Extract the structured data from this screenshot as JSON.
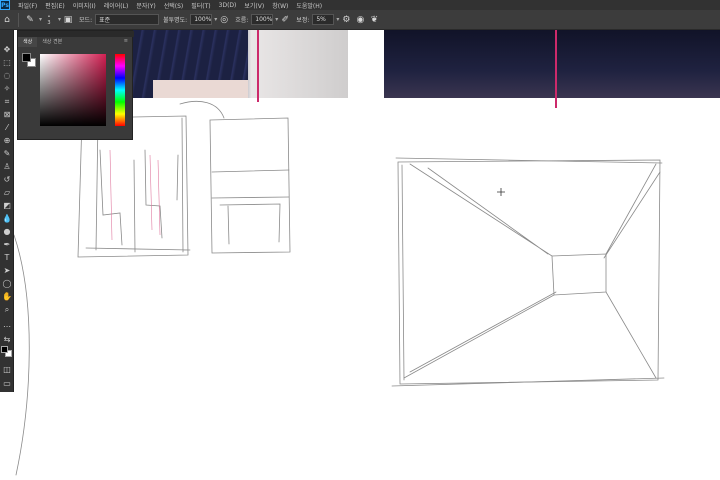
{
  "menubar": {
    "logo": "Ps",
    "items": [
      "파일(F)",
      "편집(E)",
      "이미지(I)",
      "레이어(L)",
      "문자(Y)",
      "선택(S)",
      "필터(T)",
      "3D(D)",
      "보기(V)",
      "창(W)",
      "도움말(H)"
    ]
  },
  "options": {
    "brush_size": "3",
    "mode_label": "모드:",
    "mode_value": "표준",
    "opacity_label": "불투명도:",
    "opacity_value": "100%",
    "flow_label": "흐름:",
    "flow_value": "100%",
    "smoothing_label": "보정:",
    "smoothing_value": "5%"
  },
  "color_panel": {
    "tabs": [
      "색상",
      "색상 견본"
    ],
    "fg_color": "#000000",
    "bg_color": "#ffffff",
    "selected_hue": "#d21f52"
  },
  "colors": {
    "guide_line": "#cc2a6b",
    "ui_dark": "#323232"
  }
}
